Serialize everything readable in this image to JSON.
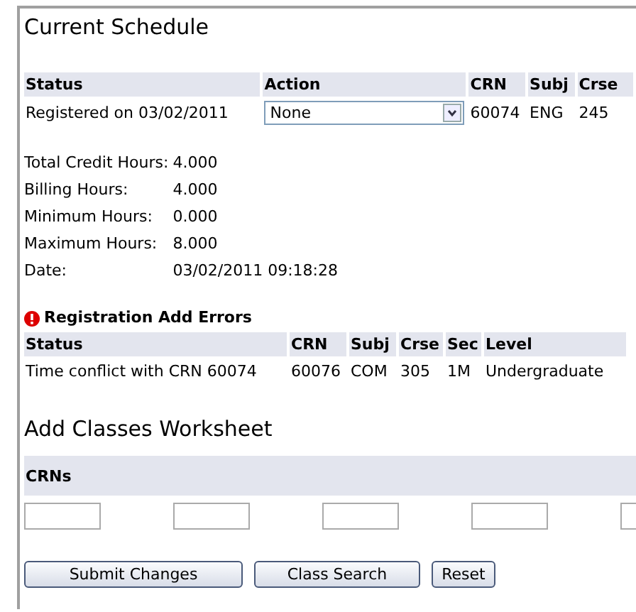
{
  "schedule": {
    "title": "Current Schedule",
    "columns": [
      "Status",
      "Action",
      "CRN",
      "Subj",
      "Crse"
    ],
    "rows": [
      {
        "status": "Registered on 03/02/2011",
        "action": "None",
        "crn": "60074",
        "subj": "ENG",
        "crse": "245"
      }
    ]
  },
  "totals": [
    {
      "label": "Total Credit Hours:",
      "value": "4.000"
    },
    {
      "label": "Billing Hours:",
      "value": "4.000"
    },
    {
      "label": "Minimum Hours:",
      "value": "0.000"
    },
    {
      "label": "Maximum Hours:",
      "value": "8.000"
    },
    {
      "label": "Date:",
      "value": "03/02/2011 09:18:28"
    }
  ],
  "errors": {
    "title": "Registration Add Errors",
    "columns": [
      "Status",
      "CRN",
      "Subj",
      "Crse",
      "Sec",
      "Level"
    ],
    "rows": [
      [
        "Time conflict with CRN 60074",
        "60076",
        "COM",
        "305",
        "1M",
        "Undergraduate"
      ]
    ]
  },
  "worksheet": {
    "title": "Add Classes Worksheet",
    "header": "CRNs"
  },
  "buttons": [
    "Submit Changes",
    "Class Search",
    "Reset"
  ]
}
